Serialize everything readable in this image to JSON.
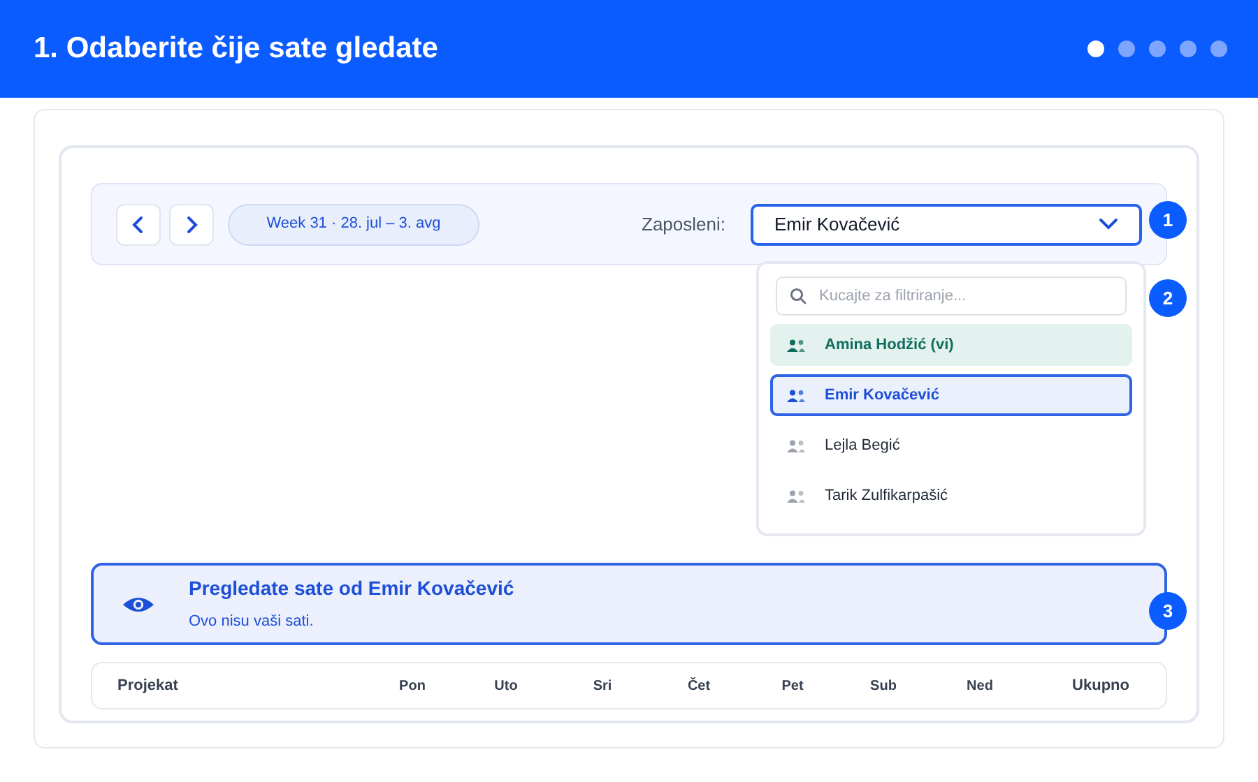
{
  "header": {
    "title": "1. Odaberite čije sate gledate",
    "steps": [
      {
        "selected": true
      },
      {
        "selected": false
      },
      {
        "selected": false
      },
      {
        "selected": false
      },
      {
        "selected": false
      }
    ]
  },
  "toolbar": {
    "week": "Week 31 · 28. jul – 3. avg",
    "employee_label": "Zaposleni:",
    "employee_value": "Emir Kovačević",
    "dropdown_expanded": true
  },
  "dropdown": {
    "placeholder": "Kucajte za filtriranje...",
    "items": [
      {
        "name": "Amina Hodžić (vi)",
        "self": true,
        "selected": false
      },
      {
        "name": "Emir Kovačević",
        "self": false,
        "selected": true
      },
      {
        "name": "Lejla Begić",
        "self": false,
        "selected": false
      },
      {
        "name": "Tarik Zulfikarpašić",
        "self": false,
        "selected": false
      }
    ]
  },
  "callouts": [
    "1",
    "2",
    "3"
  ],
  "banner": {
    "title": "Pregledate sate od Emir Kovačević",
    "subtitle": "Ovo nisu vaši sati."
  },
  "table": {
    "columns": [
      "Projekat",
      "Pon",
      "Uto",
      "Sri",
      "Čet",
      "Pet",
      "Sub",
      "Ned",
      "Ukupno"
    ]
  }
}
